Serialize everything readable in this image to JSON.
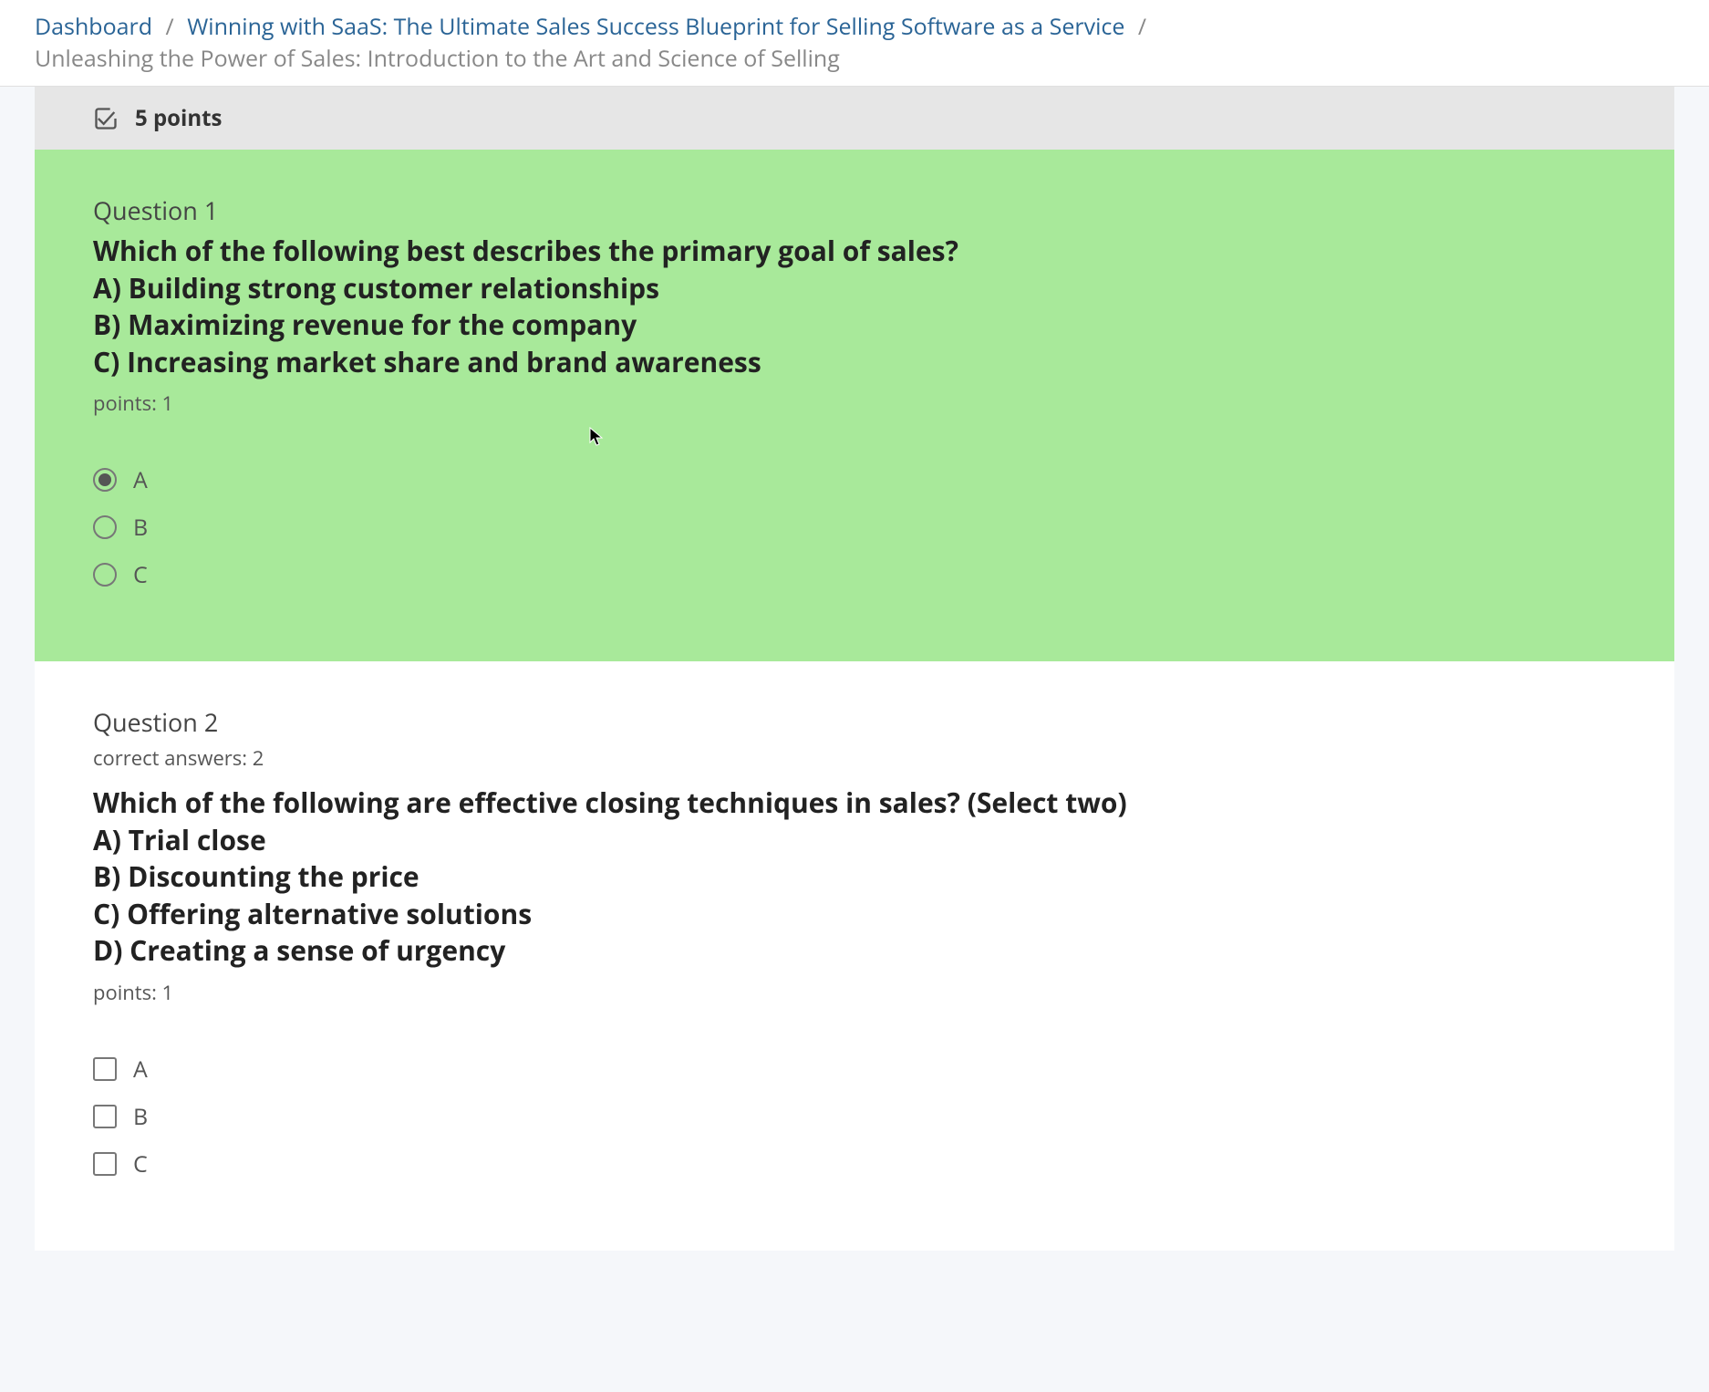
{
  "breadcrumb": {
    "dashboard": "Dashboard",
    "course": "Winning with SaaS: The Ultimate Sales Success Blueprint for Selling Software as a Service",
    "current": "Unleashing the Power of Sales: Introduction to the Art and Science of Selling"
  },
  "points_bar": {
    "label": "5 points"
  },
  "questions": [
    {
      "number": "Question 1",
      "prompt": "Which of the following best describes the primary goal of sales?",
      "body_options": [
        "A) Building strong customer relationships",
        "B) Maximizing revenue for the company",
        "C) Increasing market share and brand awareness"
      ],
      "points": "points: 1",
      "answers": [
        "A",
        "B",
        "C"
      ],
      "selected_index": 0
    },
    {
      "number": "Question 2",
      "correct_answers": "correct answers: 2",
      "prompt": "Which of the following are effective closing techniques in sales? (Select two)",
      "body_options": [
        "A) Trial close",
        "B) Discounting the price",
        "C) Offering alternative solutions",
        "D) Creating a sense of urgency"
      ],
      "points": "points: 1",
      "answers": [
        "A",
        "B",
        "C"
      ]
    }
  ]
}
